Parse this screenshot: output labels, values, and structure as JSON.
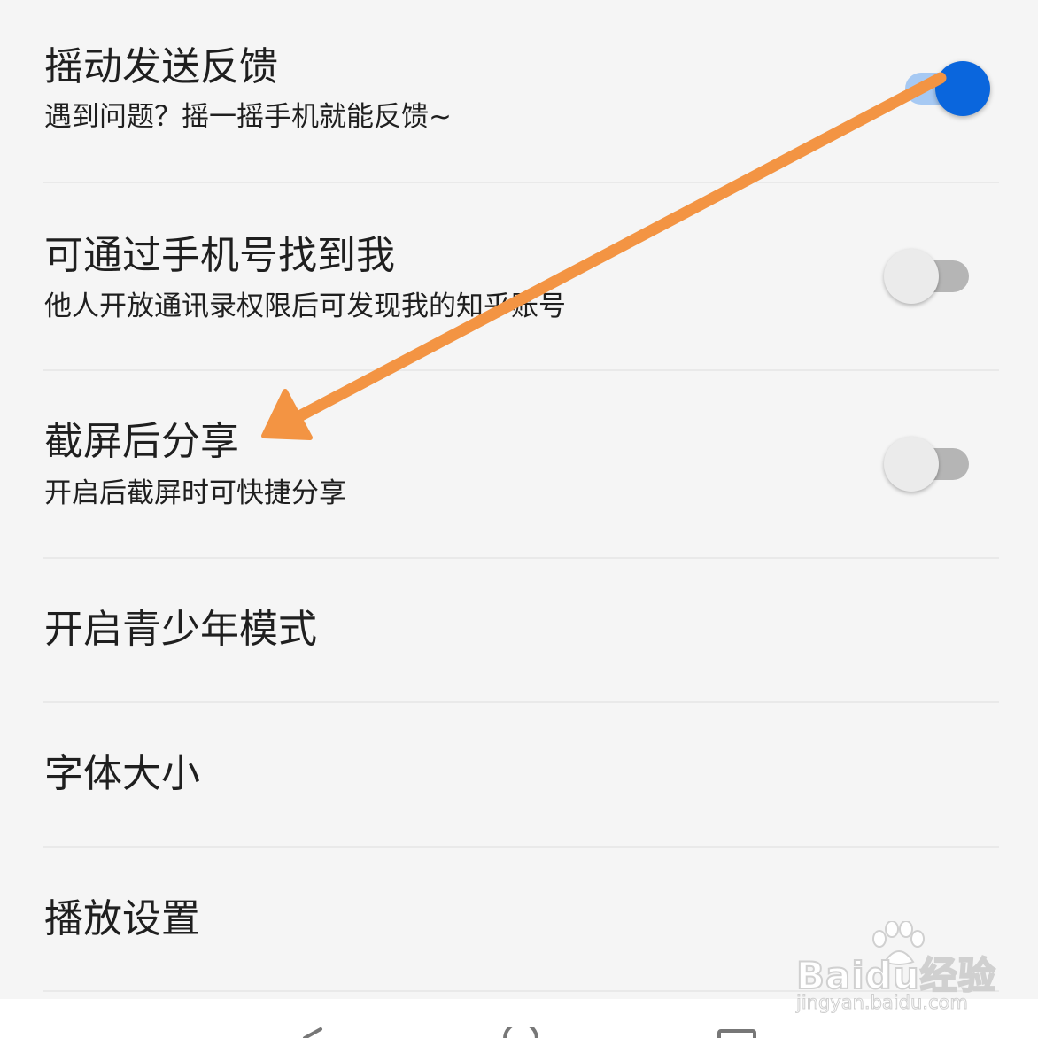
{
  "settings": [
    {
      "title": "摇动发送反馈",
      "subtitle": "遇到问题？摇一摇手机就能反馈~",
      "toggle": "on"
    },
    {
      "title": "可通过手机号找到我",
      "subtitle": "他人开放通讯录权限后可发现我的知乎账号",
      "toggle": "off"
    },
    {
      "title": "截屏后分享",
      "subtitle": "开启后截屏时可快捷分享",
      "toggle": "off"
    },
    {
      "title": "开启青少年模式"
    },
    {
      "title": "字体大小"
    },
    {
      "title": "播放设置"
    }
  ],
  "watermark": {
    "brand": "Baidu经验",
    "url": "jingyan.baidu.com"
  },
  "colors": {
    "toggle_on": "#0a66dd",
    "arrow": "#f39443",
    "background": "#f5f5f5"
  },
  "nav_icons": [
    "back-icon",
    "home-icon",
    "recents-icon"
  ]
}
